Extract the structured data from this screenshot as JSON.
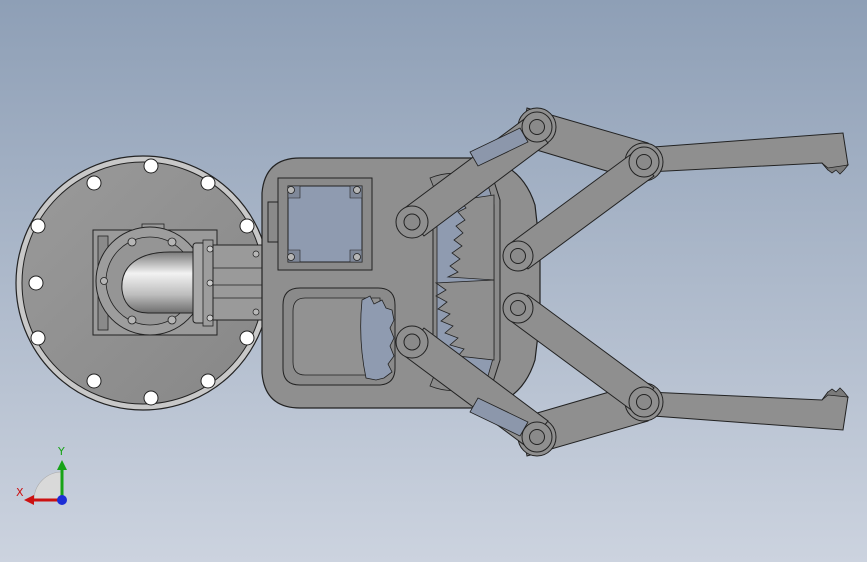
{
  "view": {
    "background_top": "#8e9fb6",
    "background_bottom": "#ccd3df",
    "part_color": "#8f8f8f",
    "edge_color": "#222222",
    "pocket_color": "#7d7d7d",
    "window_color": "#8f9bb0"
  },
  "triad": {
    "x_label": "X",
    "y_label": "Y",
    "x_color": "#cc1111",
    "y_color": "#17a317",
    "z_color": "#1c2dd6"
  }
}
